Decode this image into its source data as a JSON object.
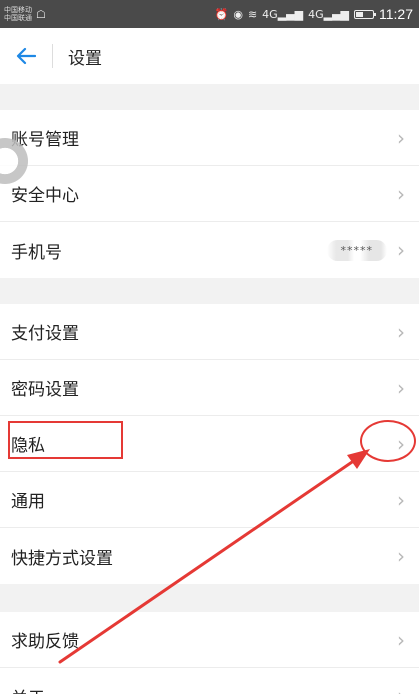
{
  "status_bar": {
    "carrier_1": "中国移动",
    "carrier_2": "中国联通",
    "network_1": "4G",
    "network_2": "4G",
    "time": "11:27"
  },
  "header": {
    "back_icon": "back-arrow-icon",
    "title": "设置"
  },
  "groups": [
    {
      "items": [
        {
          "label": "账号管理"
        },
        {
          "label": "安全中心"
        },
        {
          "label": "手机号",
          "value": "*****"
        }
      ]
    },
    {
      "items": [
        {
          "label": "支付设置"
        },
        {
          "label": "密码设置"
        },
        {
          "label": "隐私"
        },
        {
          "label": "通用"
        },
        {
          "label": "快捷方式设置"
        }
      ]
    },
    {
      "items": [
        {
          "label": "求助反馈"
        },
        {
          "label": "关于"
        }
      ]
    }
  ],
  "colors": {
    "accent": "#1e88e5",
    "annotation": "#e53935",
    "background": "#f2f2f2"
  }
}
